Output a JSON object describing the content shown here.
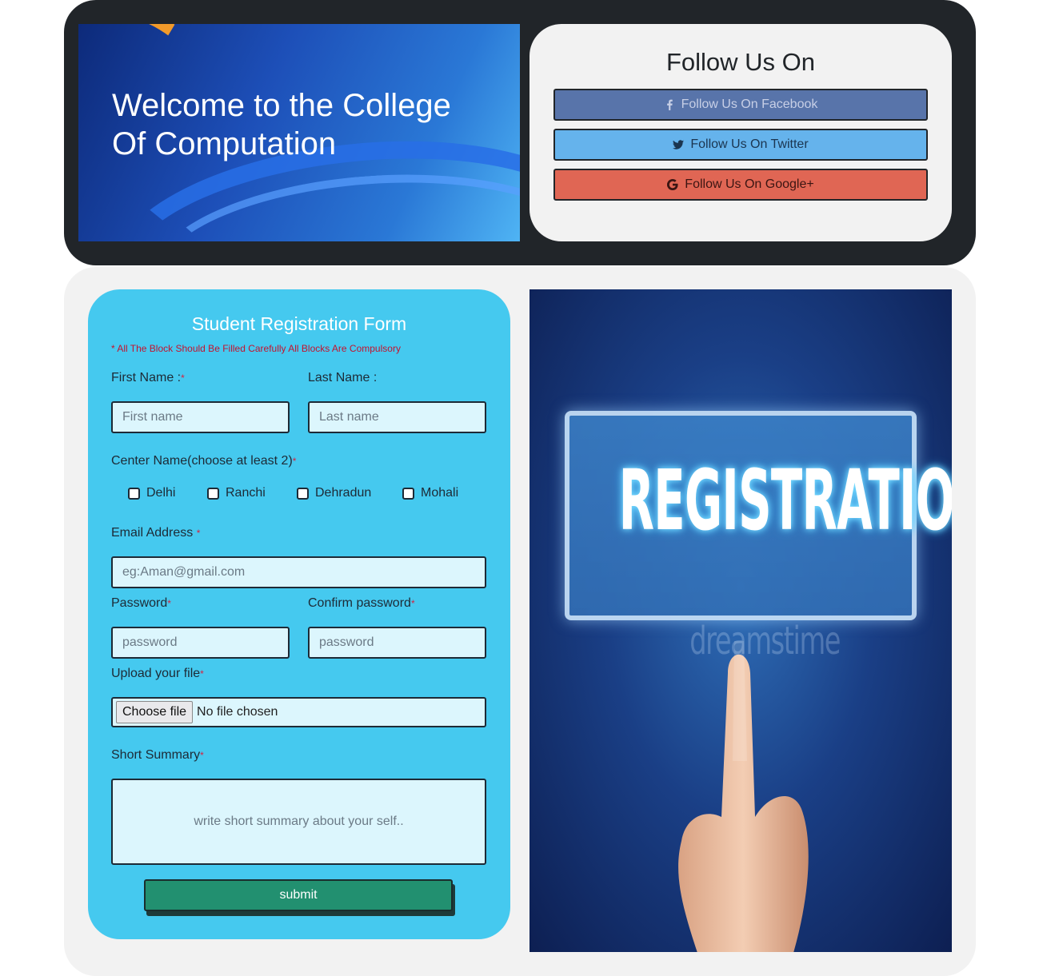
{
  "header": {
    "banner_title": "Welcome to the College Of Computation",
    "follow_title": "Follow Us On",
    "buttons": [
      {
        "label": "Follow Us On Facebook",
        "icon": "facebook-icon",
        "color": "#5874aa"
      },
      {
        "label": "Follow Us On Twitter",
        "icon": "twitter-icon",
        "color": "#65b3ec"
      },
      {
        "label": "Follow Us On Google+",
        "icon": "google-icon",
        "color": "#e06654"
      }
    ]
  },
  "form": {
    "title": "Student Registration Form",
    "note": "* All The Block Should Be Filled Carefully All Blocks Are Compulsory",
    "required_mark": "*",
    "first_name_label": "First Name :",
    "first_name_placeholder": "First name",
    "last_name_label": "Last Name :",
    "last_name_placeholder": "Last name",
    "center_label": "Center Name(choose at least 2)",
    "centers": [
      "Delhi",
      "Ranchi",
      "Dehradun",
      "Mohali"
    ],
    "email_label": "Email Address ",
    "email_placeholder": "eg:Aman@gmail.com",
    "password_label": "Password",
    "password_placeholder": "password",
    "confirm_label": "Confirm password",
    "confirm_placeholder": "password",
    "upload_label": "Upload your file",
    "file_button": "Choose file",
    "file_status": "No file chosen",
    "summary_label": "Short Summary",
    "summary_placeholder": "write short summary about your self..",
    "submit_label": "submit"
  },
  "image": {
    "text": "REGISTRATION",
    "watermark": "dreamstime"
  },
  "colors": {
    "header_bg": "#212529",
    "form_bg": "#45c9ef",
    "submit_bg": "#229070",
    "required": "#d9203f"
  }
}
